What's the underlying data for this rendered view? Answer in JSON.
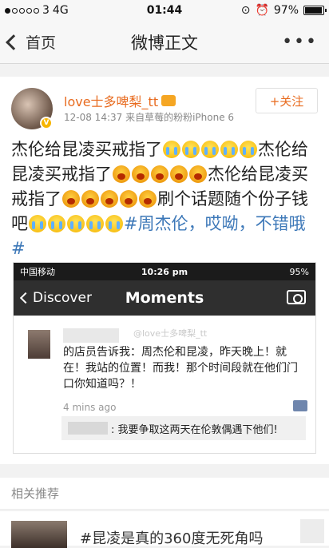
{
  "status_bar": {
    "carrier": "3",
    "network": "4G",
    "time": "01:44",
    "battery": "97%",
    "battery_level": 0.97
  },
  "nav": {
    "back_label": "首页",
    "title": "微博正文",
    "more": "•••"
  },
  "post": {
    "username": "love士多啤梨_tt",
    "meta": "12-08 14:37  来自草莓的粉粉iPhone 6",
    "follow_label": "+关注",
    "text_1": "杰伦给昆凌买戒指了",
    "text_2": "杰伦给昆凌买戒指了",
    "text_3": "杰伦给昆凌买戒指了",
    "text_4": "刷个话题随个份子钱吧",
    "hashtag": "#周杰伦，哎呦，不错哦#"
  },
  "screenshot": {
    "status_carrier": "中国移动",
    "status_time": "10:26 pm",
    "status_battery": "95%",
    "back_label": "Discover",
    "title": "Moments",
    "watermark": "@love士多啤梨_tt",
    "moment_text": "的店员告诉我：周杰伦和昆凌，昨天晚上！就在！我站的位置！而我！那个时间段就在他们门口你知道吗？！",
    "time": "4 mins ago",
    "comment": ": 我要争取这两天在伦敦偶遇下他们!"
  },
  "related": {
    "header": "相关推荐",
    "item_title": "#昆凌是真的360度无死角吗"
  },
  "colors": {
    "accent": "#e86b1f",
    "link": "#3d78b8"
  }
}
